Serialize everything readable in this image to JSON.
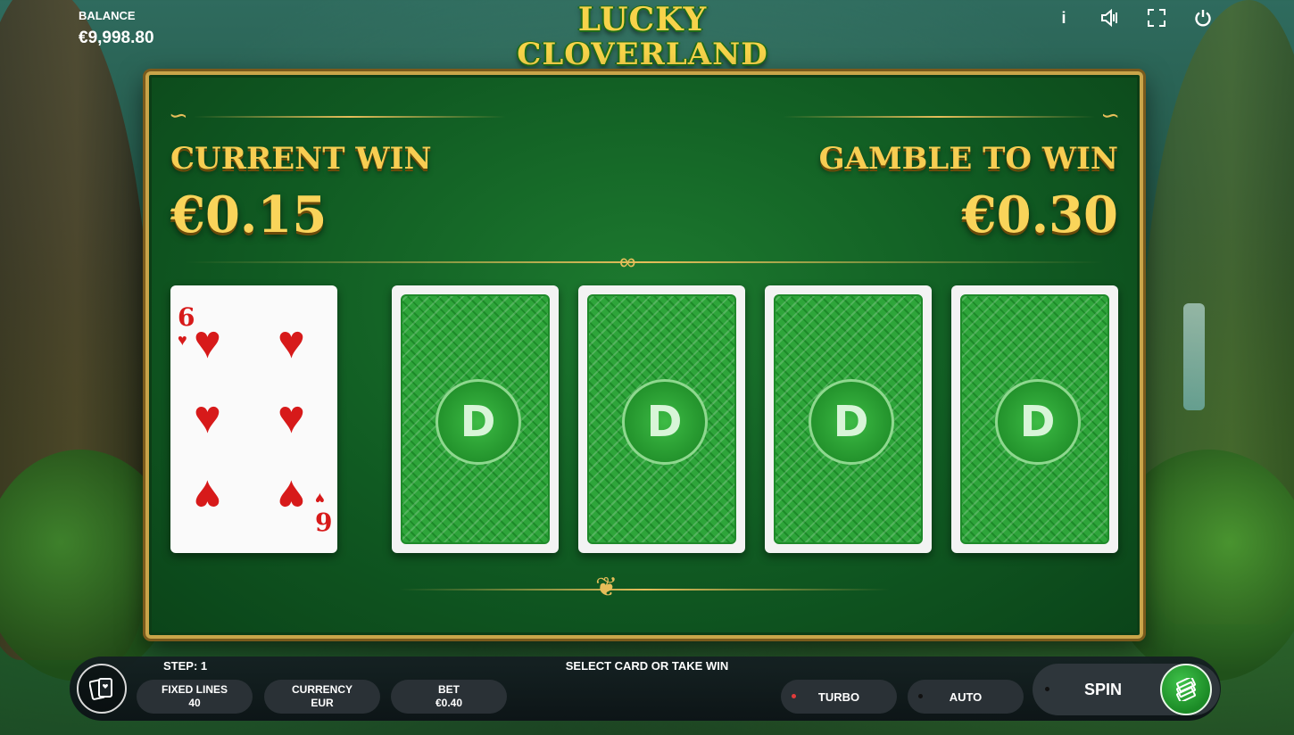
{
  "header": {
    "balance_label": "BALANCE",
    "balance_value": "€9,998.80",
    "icons": [
      "info-icon",
      "sound-icon",
      "fullscreen-icon",
      "power-icon"
    ],
    "icon_glyphs": {
      "info": "i",
      "sound": "◁",
      "fullscreen": "⛶",
      "power": "⏻"
    }
  },
  "logo": {
    "line1": "LUCKY",
    "line2": "CLOVERLAND"
  },
  "gamble": {
    "current_win_label": "CURRENT WIN",
    "current_win_value": "€0.15",
    "gamble_to_win_label": "GAMBLE TO WIN",
    "gamble_to_win_value": "€0.30"
  },
  "cards": {
    "revealed": {
      "rank": "6",
      "suit": "♥",
      "suit_name": "hearts",
      "color": "#d71a1a"
    },
    "hidden_count": 4,
    "back_emblem": "D"
  },
  "bottom": {
    "step_label": "STEP: 1",
    "status_text": "SELECT CARD OR TAKE WIN",
    "fixed_lines_label": "FIXED LINES",
    "fixed_lines_value": "40",
    "currency_label": "CURRENCY",
    "currency_value": "EUR",
    "bet_label": "BET",
    "bet_value": "€0.40",
    "turbo_label": "TURBO",
    "turbo_dot_color": "#e23b3b",
    "auto_label": "AUTO",
    "auto_dot_color": "#111111",
    "spin_label": "SPIN"
  },
  "colors": {
    "gold": "#f7cd52",
    "felt": "#105a22",
    "card_red": "#d71a1a"
  }
}
